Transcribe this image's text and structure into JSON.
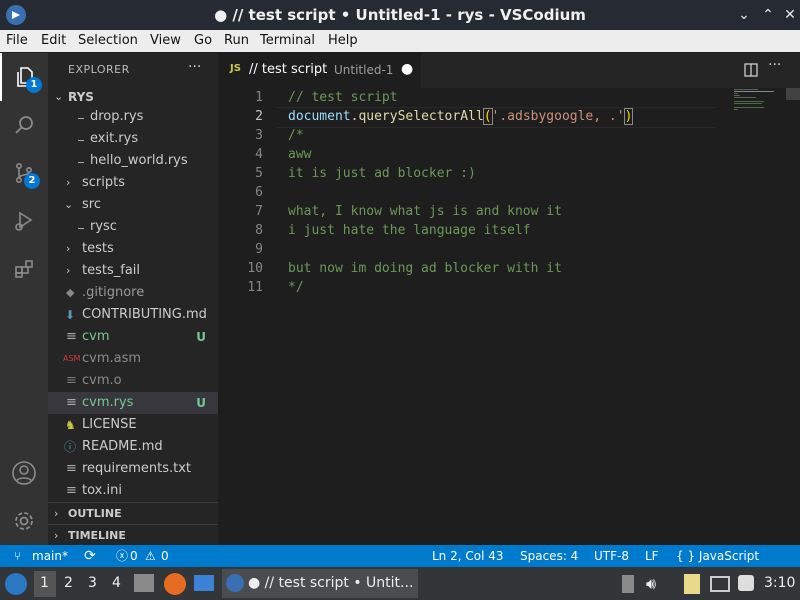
{
  "window": {
    "title": "● // test script • Untitled-1 - rys - VSCodium"
  },
  "menu": [
    "File",
    "Edit",
    "Selection",
    "View",
    "Go",
    "Run",
    "Terminal",
    "Help"
  ],
  "activity": {
    "explorer_badge": "1",
    "scm_badge": "2"
  },
  "sidebar": {
    "header": "EXPLORER",
    "root": "RYS",
    "items": [
      {
        "label": "drop.rys",
        "git": ""
      },
      {
        "label": "exit.rys",
        "git": ""
      },
      {
        "label": "hello_world.rys",
        "git": ""
      },
      {
        "label": "scripts",
        "git": ""
      },
      {
        "label": "src",
        "git": ""
      },
      {
        "label": "rysc",
        "git": ""
      },
      {
        "label": "tests",
        "git": ""
      },
      {
        "label": "tests_fail",
        "git": ""
      },
      {
        "label": ".gitignore",
        "git": ""
      },
      {
        "label": "CONTRIBUTING.md",
        "git": ""
      },
      {
        "label": "cvm",
        "git": "U"
      },
      {
        "label": "cvm.asm",
        "git": ""
      },
      {
        "label": "cvm.o",
        "git": ""
      },
      {
        "label": "cvm.rys",
        "git": "U"
      },
      {
        "label": "LICENSE",
        "git": ""
      },
      {
        "label": "README.md",
        "git": ""
      },
      {
        "label": "requirements.txt",
        "git": ""
      },
      {
        "label": "tox.ini",
        "git": ""
      }
    ],
    "outline": "OUTLINE",
    "timeline": "TIMELINE"
  },
  "tab": {
    "name": "// test script",
    "desc": "Untitled-1",
    "prefix": "JS"
  },
  "editor": {
    "lines": [
      {
        "n": "1",
        "text": "// test script"
      },
      {
        "n": "2",
        "a": "document",
        "b": ".",
        "c": "querySelectorAll",
        "d": "(",
        "e": "'.adsbygoogle, .'",
        "f": ")"
      },
      {
        "n": "3",
        "text": "/*"
      },
      {
        "n": "4",
        "text": "aww"
      },
      {
        "n": "5",
        "text": "it is just ad blocker :)"
      },
      {
        "n": "6",
        "text": ""
      },
      {
        "n": "7",
        "text": "what, I know what js is and know it"
      },
      {
        "n": "8",
        "text": "i just hate the language itself"
      },
      {
        "n": "9",
        "text": ""
      },
      {
        "n": "10",
        "text": "but now im doing ad blocker with it"
      },
      {
        "n": "11",
        "text": "*/"
      }
    ]
  },
  "status": {
    "branch": "main*",
    "problems_errors": "0",
    "problems_warnings": "0",
    "position": "Ln 2, Col 43",
    "spaces": "Spaces: 4",
    "encoding": "UTF-8",
    "eol": "LF",
    "language": "{ } JavaScript"
  },
  "taskbar": {
    "workspaces": [
      "1",
      "2",
      "3",
      "4"
    ],
    "task_title": "● // test script • Untit...",
    "clock": "3:10"
  },
  "colors": {
    "accent": "#007acc",
    "git_untracked": "#73c991",
    "comment": "#6a9955"
  }
}
